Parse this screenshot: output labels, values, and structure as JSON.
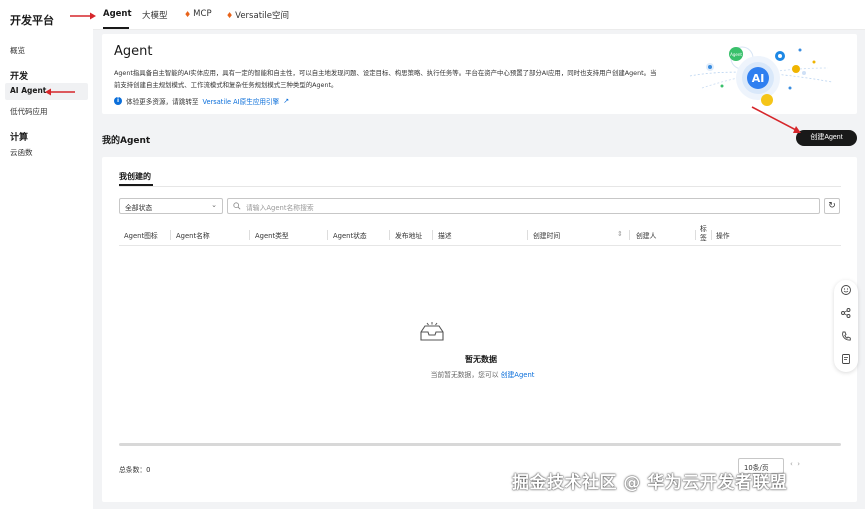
{
  "sidebar": {
    "brand": "开发平台",
    "overview": "概览",
    "group_dev": "开发",
    "ai_agent": "AI Agent",
    "lowcode": "低代码应用",
    "group_compute": "计算",
    "cloud_function": "云函数"
  },
  "tabs": [
    {
      "label": "Agent"
    },
    {
      "label": "大模型"
    },
    {
      "label": "MCP"
    },
    {
      "label": "Versatile空间"
    }
  ],
  "intro": {
    "title": "Agent",
    "desc": "Agent指具备自主智能的AI实体应用，具有一定的智能和自主性，可以自主地发现问题、设定目标、构思策略、执行任务等。平台在资产中心预置了部分AI应用，同时也支持用户创建Agent。当前支持创建自主规划模式、工作流模式和复杂任务规划模式三种类型的Agent。",
    "tip_prefix": "体验更多资源，请跳转至",
    "tip_link": "Versatile AI原生应用引擎",
    "badge_text": "AI",
    "agent_bubble": "Agent"
  },
  "section": {
    "title": "我的Agent",
    "create_button": "创建Agent"
  },
  "list": {
    "tab": "我创建的",
    "status_select": "全部状态",
    "search_placeholder": "请输入Agent名称搜索",
    "columns": [
      "Agent图标",
      "Agent名称",
      "Agent类型",
      "Agent状态",
      "发布地址",
      "描述",
      "创建时间",
      "创建人",
      "标签",
      "操作"
    ],
    "empty_title": "暂无数据",
    "empty_desc": "当前暂无数据，您可以",
    "empty_link": "创建Agent",
    "total_label": "总条数：0",
    "page_size": "10条/页"
  },
  "watermark": "掘金技术社区 @ 华为云开发者联盟",
  "colors": {
    "accent": "#0a6eda",
    "annotation_arrow": "#d6262b",
    "primary_button": "#191919"
  }
}
